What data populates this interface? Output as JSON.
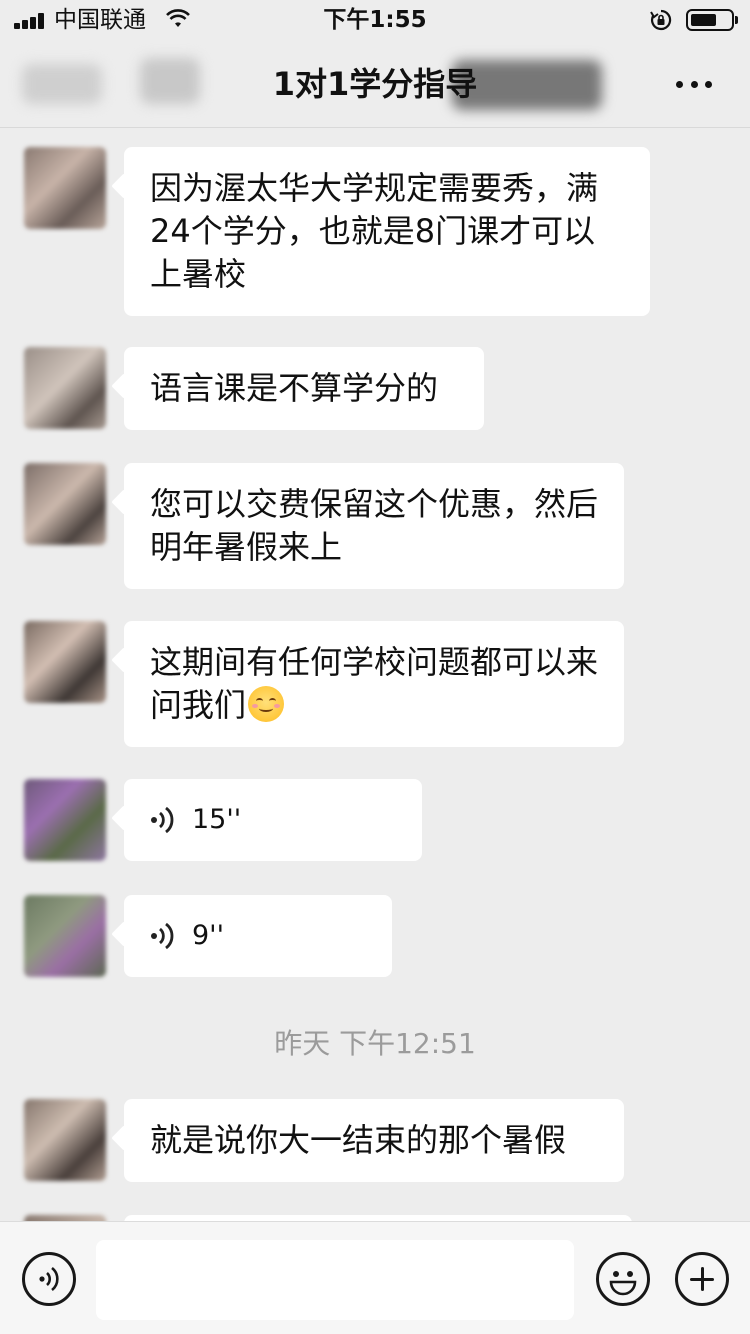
{
  "status_bar": {
    "carrier": "中国联通",
    "time": "下午1:55",
    "icons": [
      "signal-icon",
      "wifi-icon",
      "rotation-lock-icon",
      "battery-icon"
    ],
    "battery_level": 0.65
  },
  "nav": {
    "title": "1对1学分指导",
    "more_icon": "more-icon"
  },
  "messages": [
    {
      "type": "text",
      "text": "因为渥太华大学规定需要秀，满24个学分，也就是8门课才可以上暑校"
    },
    {
      "type": "text",
      "text": "语言课是不算学分的"
    },
    {
      "type": "text",
      "text": "您可以交费保留这个优惠，然后明年暑假来上"
    },
    {
      "type": "text",
      "text": "这期间有任何学校问题都可以来问我们",
      "emoji": "smiling-face-emoji"
    },
    {
      "type": "voice",
      "duration": "15''"
    },
    {
      "type": "voice",
      "duration": "9''"
    },
    {
      "type": "timestamp",
      "text": "昨天 下午12:51"
    },
    {
      "type": "text",
      "text": "就是说你大一结束的那个暑假"
    }
  ],
  "input_bar": {
    "voice_icon": "voice-toggle-icon",
    "placeholder": "",
    "emoji_icon": "emoji-icon",
    "plus_icon": "plus-icon"
  },
  "colors": {
    "background": "#ededed",
    "bubble": "#ffffff",
    "input_bar": "#f6f6f6",
    "timestamp": "#9b9b9b"
  }
}
